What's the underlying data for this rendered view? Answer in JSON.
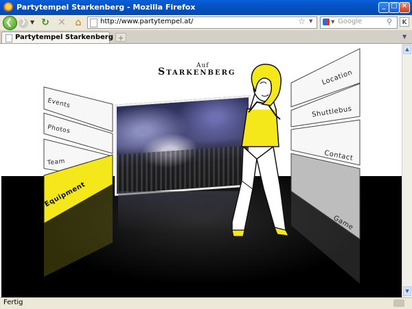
{
  "window": {
    "title": "Partytempel Starkenberg - Mozilla Firefox",
    "buttons": {
      "minimize": "_",
      "maximize": "□",
      "close": "×"
    }
  },
  "toolbar": {
    "back_icon": "back-arrow-icon",
    "forward_icon": "forward-arrow-icon",
    "reload_icon": "reload-icon",
    "stop_icon": "stop-icon",
    "home_icon": "home-icon"
  },
  "urlbar": {
    "value": "http://www.partytempel.at/"
  },
  "search": {
    "placeholder": "Google"
  },
  "tabs": [
    {
      "label": "Partytempel Starkenberg",
      "active": true
    }
  ],
  "page": {
    "logo_top": "Auf",
    "logo_main": "Starkenberg",
    "accent_color": "#f5e81a",
    "left_panels": [
      {
        "label": "Events",
        "highlighted": false
      },
      {
        "label": "Photos",
        "highlighted": false
      },
      {
        "label": "Team",
        "highlighted": false
      },
      {
        "label": "Equipment",
        "highlighted": true
      }
    ],
    "right_panels": [
      {
        "label": "Location",
        "highlighted": false
      },
      {
        "label": "Shuttlebus",
        "highlighted": false
      },
      {
        "label": "Contact",
        "highlighted": false
      },
      {
        "label": "Game",
        "highlighted": false
      }
    ]
  },
  "statusbar": {
    "text": "Fertig"
  }
}
